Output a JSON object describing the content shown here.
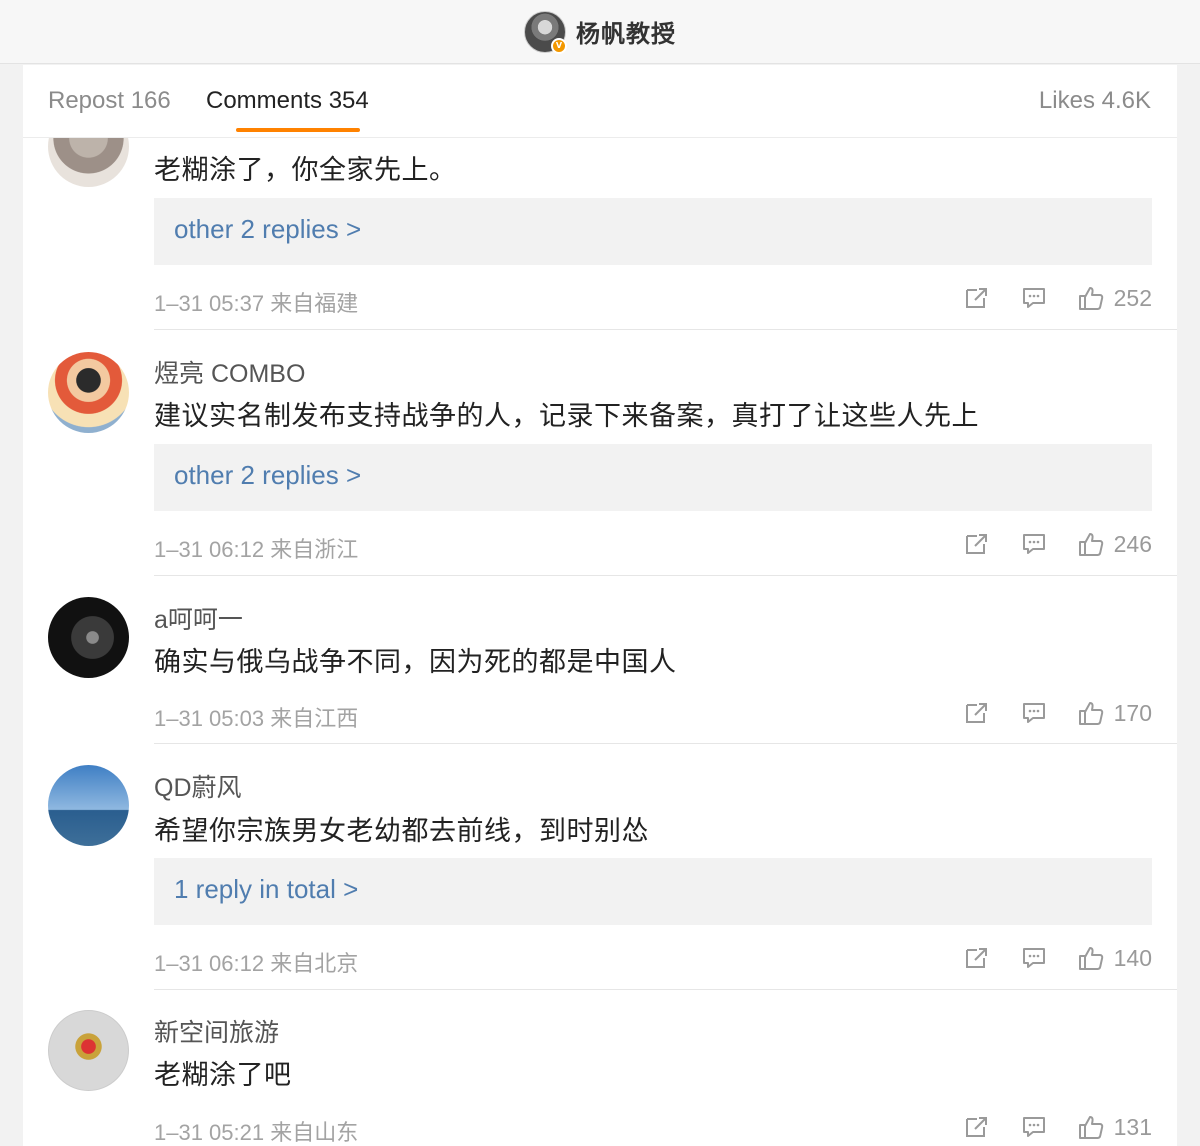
{
  "header": {
    "account_name": "杨帆教授",
    "verified_badge": "V"
  },
  "tabs": {
    "repost": "Repost 166",
    "comments": "Comments 354",
    "likes": "Likes 4.6K",
    "accent_color": "#ff8200"
  },
  "comments": [
    {
      "username": "",
      "text": "老糊涂了，你全家先上。",
      "replies_label": "other 2 replies >",
      "meta": "1–31 05:37 来自福建",
      "likes": "252"
    },
    {
      "username": "煜亮 COMBO",
      "text": "建议实名制发布支持战争的人，记录下来备案，真打了让这些人先上",
      "replies_label": "other 2 replies >",
      "meta": "1–31 06:12 来自浙江",
      "likes": "246"
    },
    {
      "username": "a呵呵一",
      "text": "确实与俄乌战争不同，因为死的都是中国人",
      "replies_label": "",
      "meta": "1–31 05:03 来自江西",
      "likes": "170"
    },
    {
      "username": "QD蔚风",
      "text": "希望你宗族男女老幼都去前线，到时别怂",
      "replies_label": "1 reply in total >",
      "meta": "1–31 06:12 来自北京",
      "likes": "140"
    },
    {
      "username": "新空间旅游",
      "text": "老糊涂了吧",
      "replies_label": "",
      "meta": "1–31 05:21 来自山东",
      "likes": "131"
    }
  ],
  "colors": {
    "link": "#507daf",
    "meta": "#a3a3a3"
  }
}
